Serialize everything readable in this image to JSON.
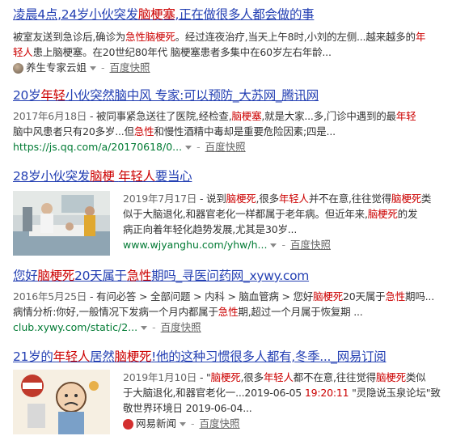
{
  "results": [
    {
      "title": [
        {
          "t": "凌晨4点,24岁小伙突发"
        },
        {
          "t": "脑梗塞",
          "hl": true
        },
        {
          "t": ",正在做很多人都会做的事"
        }
      ],
      "lines": [
        [
          {
            "t": "被室友送到急诊后,确诊为"
          },
          {
            "t": "急性脑梗死",
            "hl": true
          },
          {
            "t": "。经过连夜治疗,当天上午8时,小刘的左侧...越来越多的"
          },
          {
            "t": "年",
            "hl": true
          }
        ],
        [
          {
            "t": "轻人",
            "hl": true
          },
          {
            "t": "患上脑梗塞。在20世纪80年代 脑梗塞患者多集中在60岁左右年龄..."
          }
        ]
      ],
      "meta_url": "",
      "meta_source": "养生专家云姐",
      "cache": "百度快照"
    },
    {
      "title": [
        {
          "t": "20岁"
        },
        {
          "t": "年轻",
          "hl": true
        },
        {
          "t": "小伙突然脑中风 专家:可以预防_大苏网_腾讯网"
        }
      ],
      "lines": [
        [
          {
            "t": "2017年6月18日",
            "date": true
          },
          {
            "t": " - 被同事紧急送往了医院,经检查,"
          },
          {
            "t": "脑梗塞",
            "hl": true
          },
          {
            "t": ",就是大家...多,门诊中遇到的最"
          },
          {
            "t": "年轻",
            "hl": true
          }
        ],
        [
          {
            "t": "脑中风患者只有20多岁...但"
          },
          {
            "t": "急性",
            "hl": true
          },
          {
            "t": "和慢性酒精中毒却是重要危险因素;四是..."
          }
        ]
      ],
      "meta_url": "https://js.qq.com/a/20170618/0...",
      "meta_source": "",
      "cache": "百度快照"
    },
    {
      "title": [
        {
          "t": "28岁小伙突发"
        },
        {
          "t": "脑梗",
          "hl": true
        },
        {
          "t": " "
        },
        {
          "t": "年轻人",
          "hl": true
        },
        {
          "t": "要当心"
        }
      ],
      "lines": [
        [
          {
            "t": "2019年7月17日",
            "date": true
          },
          {
            "t": " - 说到"
          },
          {
            "t": "脑梗死",
            "hl": true
          },
          {
            "t": ",很多"
          },
          {
            "t": "年轻人",
            "hl": true
          },
          {
            "t": "并不在意,往往觉得"
          },
          {
            "t": "脑梗死",
            "hl": true
          },
          {
            "t": "类"
          }
        ],
        [
          {
            "t": "似于大脑退化,和器官老化一样都属于老年病。但近年来,"
          },
          {
            "t": "脑梗死",
            "hl": true
          },
          {
            "t": "的发"
          }
        ],
        [
          {
            "t": "病正向着年轻化趋势发展,尤其是30岁..."
          }
        ]
      ],
      "meta_url": "www.wjyanghu.com/yhw/h...",
      "meta_source": "",
      "cache": "百度快照"
    },
    {
      "title": [
        {
          "t": "您好"
        },
        {
          "t": "脑梗死",
          "hl": true
        },
        {
          "t": "20天属于"
        },
        {
          "t": "急性",
          "hl": true
        },
        {
          "t": "期吗_寻医问药网_xywy.com"
        }
      ],
      "lines": [
        [
          {
            "t": "2016年5月25日",
            "date": true
          },
          {
            "t": " - 有问必答 > 全部问题 > 内科 > 脑血管病 > 您好"
          },
          {
            "t": "脑梗死",
            "hl": true
          },
          {
            "t": "20天属于"
          },
          {
            "t": "急性",
            "hl": true
          },
          {
            "t": "期吗..."
          }
        ],
        [
          {
            "t": "病情分析:你好,一般情况下发病一个月内都属于"
          },
          {
            "t": "急性",
            "hl": true
          },
          {
            "t": "期,超过一个月属于恢复期 ..."
          }
        ]
      ],
      "meta_url": "club.xywy.com/static/2...",
      "meta_source": "",
      "cache": "百度快照"
    },
    {
      "title": [
        {
          "t": "21岁的"
        },
        {
          "t": "年轻人",
          "hl": true
        },
        {
          "t": "居然"
        },
        {
          "t": "脑梗死",
          "hl": true
        },
        {
          "t": "!他的这种习惯很多人都有,冬季..._网易订阅"
        }
      ],
      "lines": [
        [
          {
            "t": "2019年1月10日",
            "date": true
          },
          {
            "t": " - \""
          },
          {
            "t": "脑梗死",
            "hl": true
          },
          {
            "t": ",很多"
          },
          {
            "t": "年轻人",
            "hl": true
          },
          {
            "t": "都不在意,往往觉得"
          },
          {
            "t": "脑梗死",
            "hl": true
          },
          {
            "t": "类似"
          }
        ],
        [
          {
            "t": "于大脑退化,和器官老化一...2019-06-05 "
          },
          {
            "t": "19:20:11",
            "hl": true
          },
          {
            "t": " \"灵隐说玉泉论坛\"致"
          }
        ],
        [
          {
            "t": "敬世界环境日 2019-06-04..."
          }
        ]
      ],
      "meta_url": "",
      "meta_source": "网易新闻",
      "cache": "百度快照"
    }
  ],
  "colors": {
    "title": "#2440b3",
    "highlight": "#cc0000",
    "url": "#007a33"
  },
  "icons": {
    "result1_source": "avatar-icon",
    "result5_source": "netease-logo-icon",
    "dropdown": "dropdown-arrow-icon"
  }
}
